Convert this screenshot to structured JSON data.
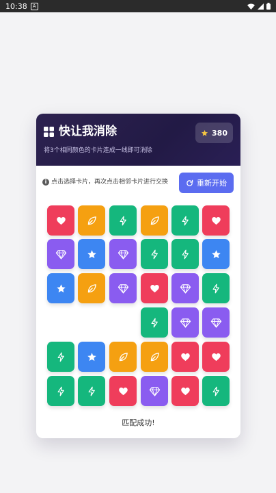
{
  "statusbar": {
    "time": "10:38",
    "notif_letter": "A"
  },
  "header": {
    "title": "快让我消除",
    "subtitle": "将3个相同颜色的卡片连成一线即可消除",
    "score": "380"
  },
  "hint": "点击选择卡片，再次点击相邻卡片进行交换",
  "restart_label": "重新开始",
  "status_message": "匹配成功!",
  "colors": {
    "heart": "#ef3d5b",
    "leaf": "#f5a011",
    "bolt": "#15b77d",
    "diamond": "#8a5cf0",
    "star": "#3d86f2",
    "accent": "#5b6cf0",
    "header_bg": "#2d2250"
  },
  "board": {
    "rows": [
      [
        "heart",
        "leaf",
        "bolt",
        "leaf",
        "bolt",
        "heart"
      ],
      [
        "diamond",
        "star",
        "diamond",
        "bolt",
        "bolt",
        "star"
      ],
      [
        "star",
        "leaf",
        "diamond",
        "heart",
        "diamond",
        "bolt"
      ],
      [
        null,
        null,
        null,
        "bolt",
        "diamond",
        "diamond"
      ],
      [
        "bolt",
        "star",
        "leaf",
        "leaf",
        "heart",
        "heart"
      ],
      [
        "bolt",
        "bolt",
        "heart",
        "diamond",
        "heart",
        "bolt"
      ]
    ]
  }
}
